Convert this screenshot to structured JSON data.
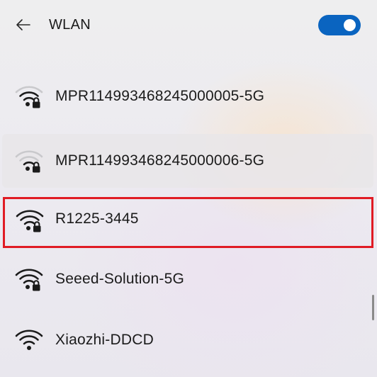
{
  "header": {
    "title": "WLAN",
    "back_icon": "back-arrow-icon",
    "toggle_state": "on",
    "accent_color": "#0a64c0"
  },
  "networks": [
    {
      "ssid": "MPR114993468245000005-5G",
      "secured": true,
      "icon": "wifi-secured-icon"
    },
    {
      "ssid": "MPR114993468245000006-5G",
      "secured": true,
      "icon": "wifi-secured-icon"
    },
    {
      "ssid": "R1225-3445",
      "secured": true,
      "icon": "wifi-secured-icon"
    },
    {
      "ssid": "Seeed-Solution-5G",
      "secured": true,
      "icon": "wifi-secured-icon"
    },
    {
      "ssid": "Xiaozhi-DDCD",
      "secured": false,
      "icon": "wifi-icon"
    }
  ],
  "highlight_color": "#e01b24"
}
